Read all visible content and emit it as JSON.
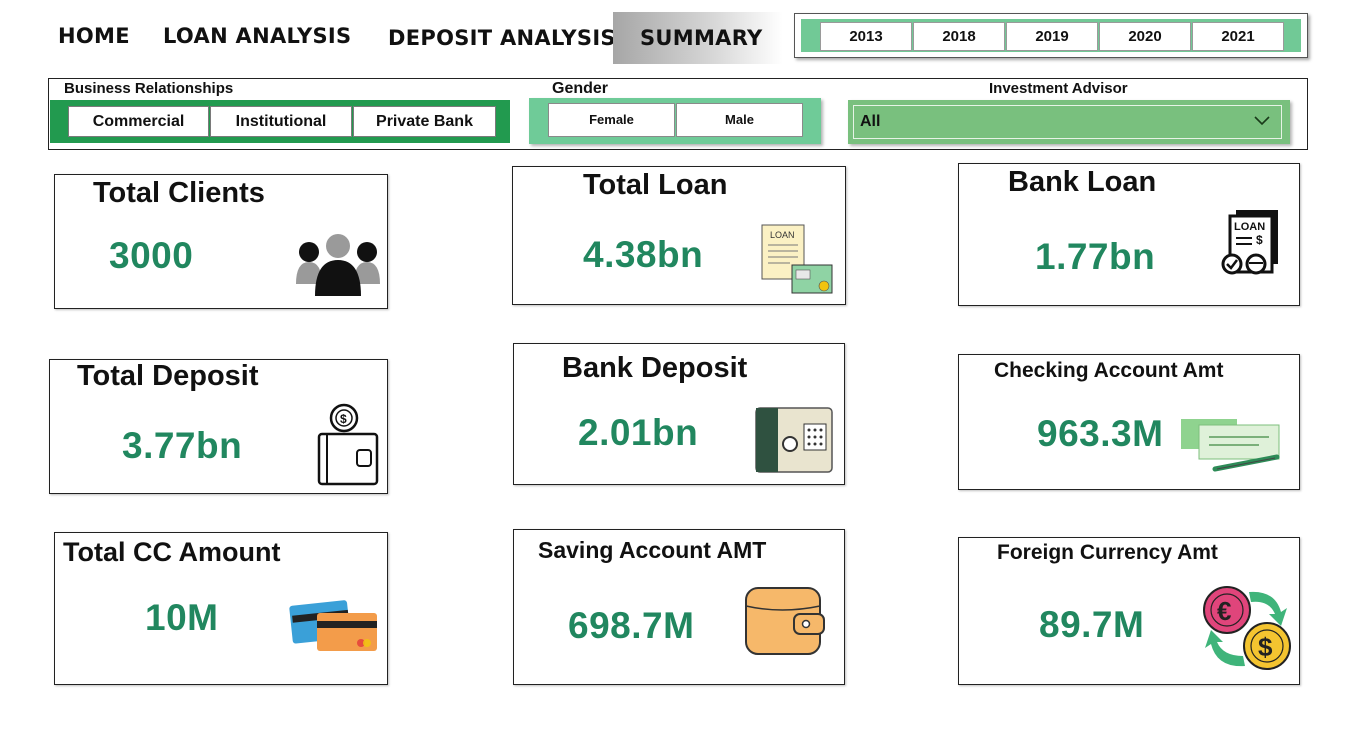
{
  "nav": {
    "home": "HOME",
    "loan_analysis": "LOAN ANALYSIS",
    "deposit_analysis": "DEPOSIT ANALYSIS",
    "summary": "SUMMARY"
  },
  "year_slicer": {
    "years": [
      "2013",
      "2018",
      "2019",
      "2020",
      "2021"
    ]
  },
  "filters": {
    "business": {
      "title": "Business Relationships",
      "options": [
        "Commercial",
        "Institutional",
        "Private Bank"
      ]
    },
    "gender": {
      "title": "Gender",
      "options": [
        "Female",
        "Male"
      ]
    },
    "advisor": {
      "title": "Investment Advisor",
      "value": "All"
    }
  },
  "cards": {
    "total_clients": {
      "title": "Total Clients",
      "value": "3000",
      "icon": "people-icon"
    },
    "total_loan": {
      "title": "Total Loan",
      "value": "4.38bn",
      "icon": "loan-document-icon"
    },
    "bank_loan": {
      "title": "Bank Loan",
      "value": "1.77bn",
      "icon": "bank-loan-icon"
    },
    "total_deposit": {
      "title": "Total Deposit",
      "value": "3.77bn",
      "icon": "wallet-coin-icon"
    },
    "bank_deposit": {
      "title": "Bank Deposit",
      "value": "2.01bn",
      "icon": "safe-icon"
    },
    "checking": {
      "title": "Checking  Account Amt",
      "value": "963.3M",
      "icon": "cheque-icon"
    },
    "total_cc": {
      "title": "Total CC Amount",
      "value": "10M",
      "icon": "credit-cards-icon"
    },
    "saving": {
      "title": "Saving Account AMT",
      "value": "698.7M",
      "icon": "wallet-icon"
    },
    "foreign": {
      "title": "Foreign Currency Amt",
      "value": "89.7M",
      "icon": "currency-exchange-icon"
    }
  },
  "colors": {
    "value_green": "#21875f",
    "slicer_green": "#71c996",
    "business_green": "#229a4f",
    "advisor_green": "#79c07e"
  }
}
